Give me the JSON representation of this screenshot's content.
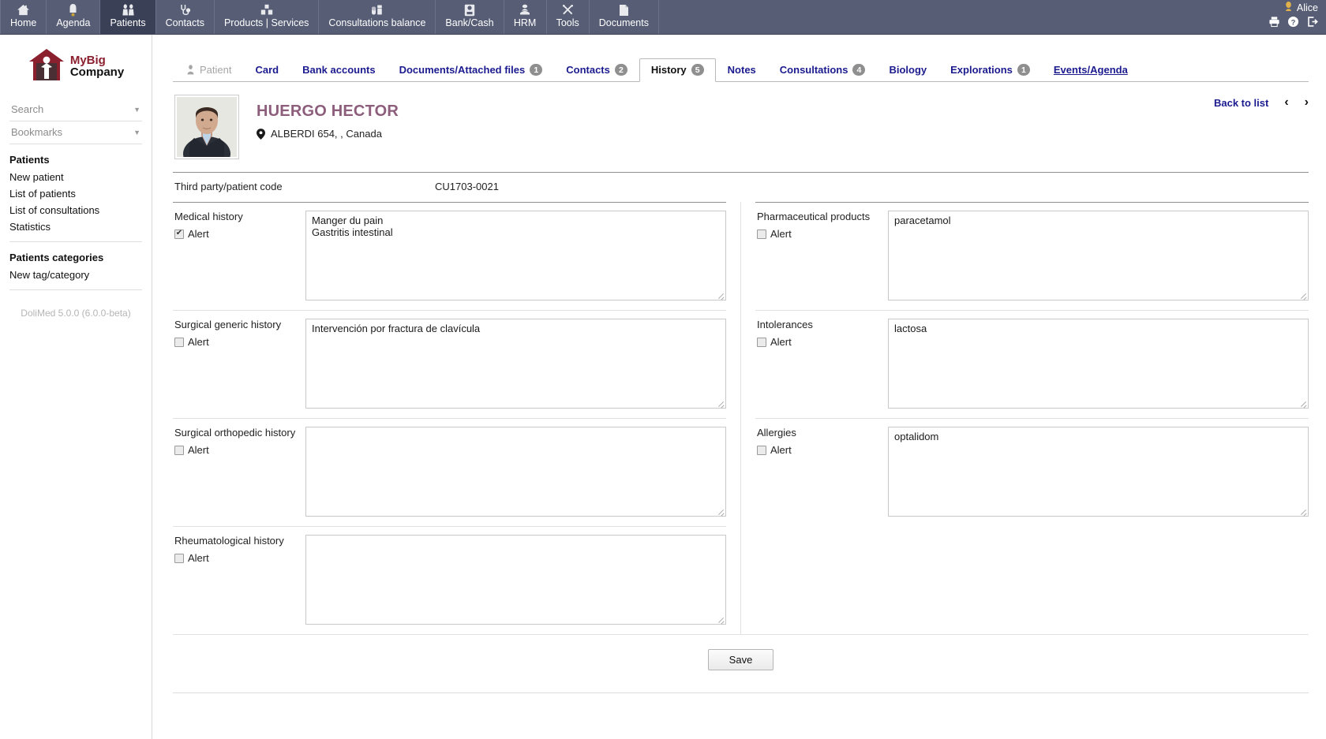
{
  "topbar": {
    "menu": [
      {
        "label": "Home",
        "icon": "home-icon",
        "active": false
      },
      {
        "label": "Agenda",
        "icon": "calendar-icon",
        "active": false
      },
      {
        "label": "Patients",
        "icon": "patients-icon",
        "active": true
      },
      {
        "label": "Contacts",
        "icon": "stethoscope-icon",
        "active": false
      },
      {
        "label": "Products | Services",
        "icon": "boxes-icon",
        "active": false
      },
      {
        "label": "Consultations balance",
        "icon": "pills-icon",
        "active": false
      },
      {
        "label": "Bank/Cash",
        "icon": "bank-icon",
        "active": false
      },
      {
        "label": "HRM",
        "icon": "hrm-icon",
        "active": false
      },
      {
        "label": "Tools",
        "icon": "tools-icon",
        "active": false
      },
      {
        "label": "Documents",
        "icon": "documents-icon",
        "active": false
      }
    ],
    "user": "Alice",
    "user_icon": "user-icon",
    "actions": [
      {
        "name": "print-icon",
        "glyph": "⎙"
      },
      {
        "name": "help-icon",
        "glyph": "?"
      },
      {
        "name": "logout-icon",
        "glyph": "↪"
      }
    ]
  },
  "sidebar": {
    "logo_line1": "MyBig",
    "logo_line2": "Company",
    "search_placeholder": "Search",
    "bookmarks_placeholder": "Bookmarks",
    "groups": [
      {
        "title": "Patients",
        "links": [
          "New patient",
          "List of patients",
          "List of consultations",
          "Statistics"
        ]
      },
      {
        "title": "Patients categories",
        "links": [
          "New tag/category"
        ]
      }
    ],
    "version": "DoliMed 5.0.0 (6.0.0-beta)"
  },
  "tabs": [
    {
      "label": "Patient",
      "badge": null,
      "state": "disabled",
      "icon": "patient-icon"
    },
    {
      "label": "Card",
      "badge": null,
      "state": "link"
    },
    {
      "label": "Bank accounts",
      "badge": null,
      "state": "link"
    },
    {
      "label": "Documents/Attached files",
      "badge": "1",
      "state": "link"
    },
    {
      "label": "Contacts",
      "badge": "2",
      "state": "link"
    },
    {
      "label": "History",
      "badge": "5",
      "state": "active"
    },
    {
      "label": "Notes",
      "badge": null,
      "state": "link"
    },
    {
      "label": "Consultations",
      "badge": "4",
      "state": "link"
    },
    {
      "label": "Biology",
      "badge": null,
      "state": "link"
    },
    {
      "label": "Explorations",
      "badge": "1",
      "state": "link"
    },
    {
      "label": "Events/Agenda",
      "badge": null,
      "state": "link-underlined"
    }
  ],
  "patient": {
    "name": "HUERGO HECTOR",
    "address": "ALBERDI 654, , Canada",
    "back_to_list": "Back to list",
    "prev_arrow": "‹",
    "next_arrow": "›",
    "code_label": "Third party/patient code",
    "code_value": "CU1703-0021"
  },
  "form": {
    "alert_label": "Alert",
    "left": [
      {
        "label": "Medical history",
        "alert": true,
        "value": "Manger du pain\nGastritis intestinal"
      },
      {
        "label": "Surgical generic history",
        "alert": false,
        "value": "Intervención por fractura de clavícula"
      },
      {
        "label": "Surgical orthopedic history",
        "alert": false,
        "value": ""
      },
      {
        "label": "Rheumatological history",
        "alert": false,
        "value": ""
      }
    ],
    "right": [
      {
        "label": "Pharmaceutical products",
        "alert": false,
        "value": "paracetamol"
      },
      {
        "label": "Intolerances",
        "alert": false,
        "value": "lactosa"
      },
      {
        "label": "Allergies",
        "alert": false,
        "value": "optalidom"
      }
    ],
    "save_label": "Save"
  },
  "colors": {
    "topbar_bg": "#565d74",
    "topbar_active": "#3a4056",
    "link": "#1b1b8f",
    "patient_name": "#8d5d7c",
    "badge": "#8f8f8f",
    "logo_red": "#8a1f2e"
  }
}
